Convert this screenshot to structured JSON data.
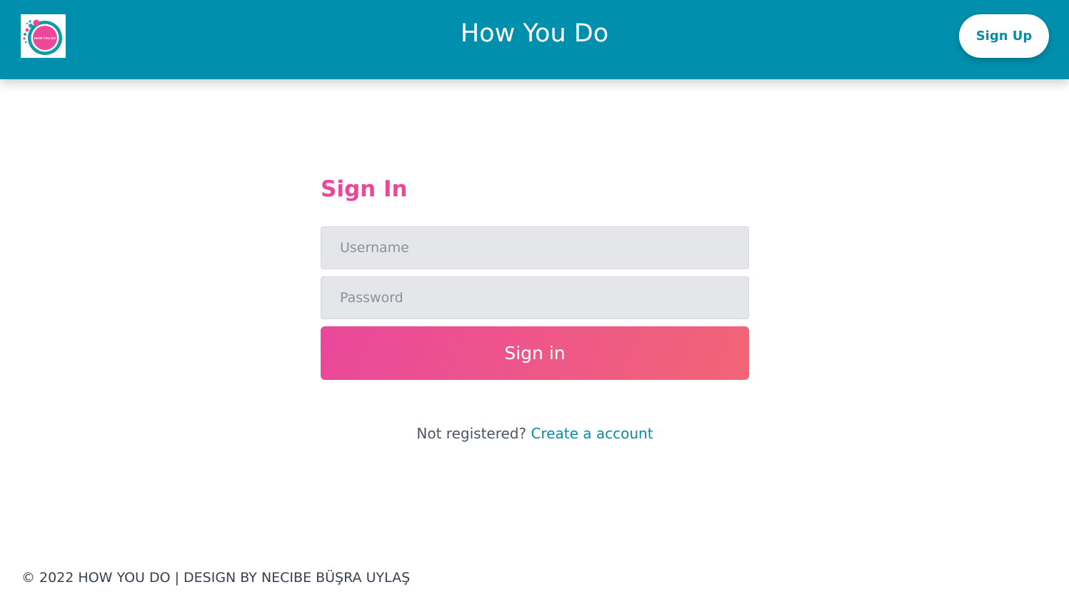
{
  "header": {
    "logo_text": "HOW YOU DO",
    "title": "How You Do",
    "signup_label": "Sign Up"
  },
  "form": {
    "title": "Sign In",
    "username": {
      "placeholder": "Username",
      "value": ""
    },
    "password": {
      "placeholder": "Password",
      "value": ""
    },
    "submit_label": "Sign in"
  },
  "register": {
    "prompt": "Not registered?",
    "link_label": "Create a account"
  },
  "footer": {
    "text": "© 2022 HOW YOU DO | DESIGN BY NECIBE BÜŞRA UYLAŞ"
  },
  "colors": {
    "header_bg": "#0090ad",
    "accent_pink": "#ec4899",
    "link_teal": "#0a8ca6",
    "input_bg": "#e5e6ea",
    "gradient_start": "#e9489b",
    "gradient_end": "#f26576"
  }
}
